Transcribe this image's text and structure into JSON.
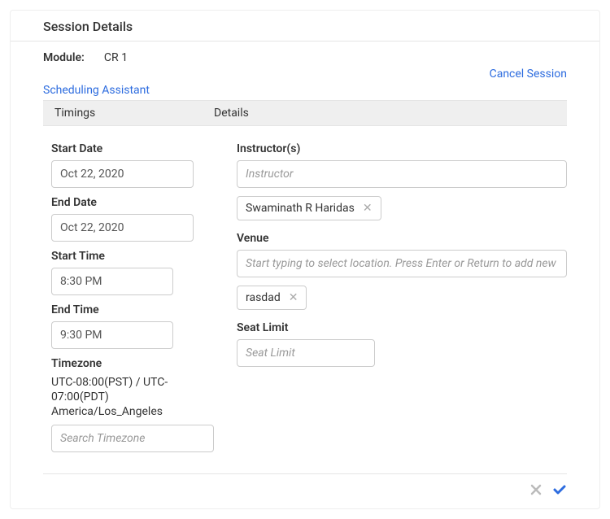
{
  "header": {
    "title": "Session Details"
  },
  "module": {
    "label": "Module:",
    "value": "CR 1"
  },
  "links": {
    "cancel_session": "Cancel Session",
    "scheduling_assistant": "Scheduling Assistant"
  },
  "section_headers": {
    "timings": "Timings",
    "details": "Details"
  },
  "timings": {
    "start_date_label": "Start Date",
    "start_date_value": "Oct 22, 2020",
    "end_date_label": "End Date",
    "end_date_value": "Oct 22, 2020",
    "start_time_label": "Start Time",
    "start_time_value": "8:30 PM",
    "end_time_label": "End Time",
    "end_time_value": "9:30 PM",
    "timezone_label": "Timezone",
    "timezone_text": "UTC-08:00(PST) / UTC-07:00(PDT) America/Los_Angeles",
    "timezone_placeholder": "Search Timezone"
  },
  "details": {
    "instructors_label": "Instructor(s)",
    "instructor_placeholder": "Instructor",
    "instructor_chip": "Swaminath R Haridas",
    "venue_label": "Venue",
    "venue_placeholder": "Start typing to select location. Press Enter or Return to add new location.",
    "venue_chip": "rasdad",
    "seat_limit_label": "Seat Limit",
    "seat_limit_placeholder": "Seat Limit"
  }
}
